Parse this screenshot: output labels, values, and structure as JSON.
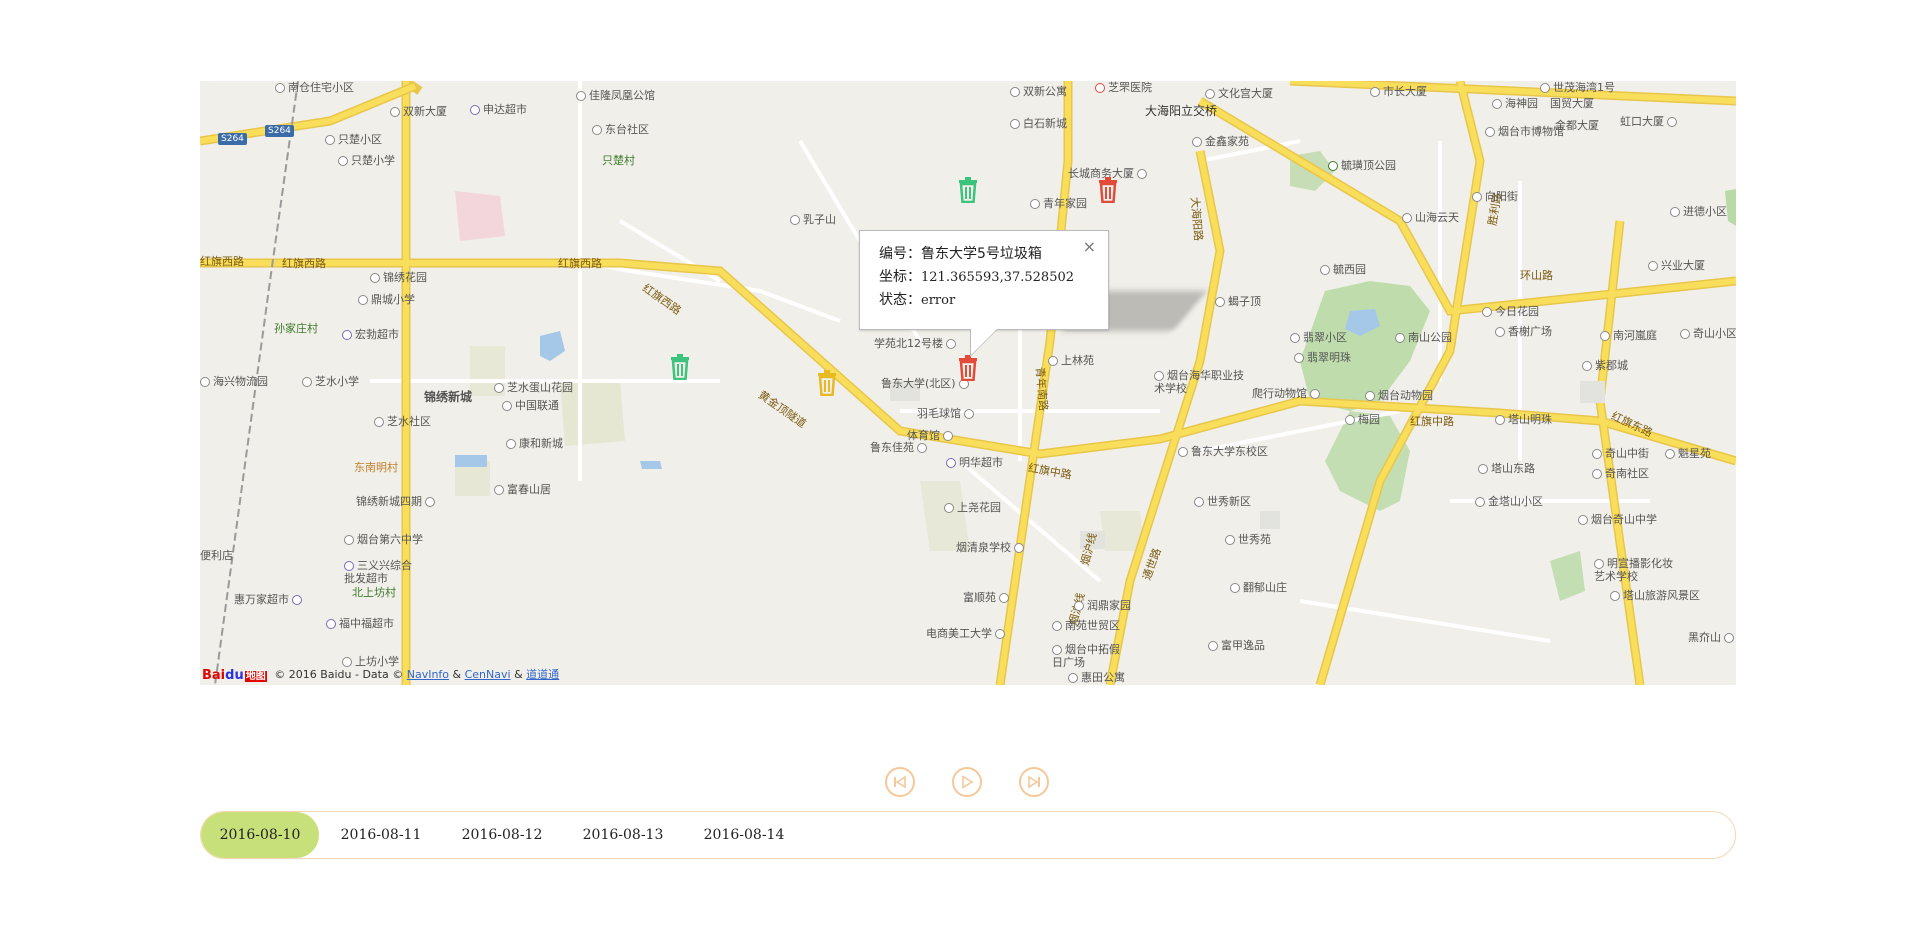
{
  "map": {
    "popup": {
      "id_label": "编号：",
      "id_value": "鲁东大学5号垃圾箱",
      "coord_label": "坐标：",
      "coord_value": "121.365593,37.528502",
      "status_label": "状态：",
      "status_value": "error",
      "close_glyph": "×"
    },
    "attribution": {
      "logo_bai": "Bai",
      "logo_du": "du",
      "logo_map": "地图",
      "copyright": "© 2016 Baidu - Data ©",
      "navinfo": "NavInfo",
      "amp1": "&",
      "cennavi": "CenNavi",
      "amp2": "&",
      "daodaotong": "道道通"
    },
    "bins": [
      {
        "status": "green",
        "color": "#3cc47c"
      },
      {
        "status": "red",
        "color": "#e24a3a"
      },
      {
        "status": "green",
        "color": "#3cc47c"
      },
      {
        "status": "yellow",
        "color": "#e7b923"
      },
      {
        "status": "red-selected",
        "color": "#e24a3a"
      }
    ],
    "pois": [
      "南仓住宅小区",
      "双新大厦",
      "申达超市",
      "佳隆凤凰公馆",
      "双新公寓",
      "芝罘医院",
      "文化宫大厦",
      "市长大厦",
      "世茂海湾1号",
      "只楚小区",
      "东台社区",
      "白石新城",
      "大海阳立交桥",
      "金鑫家苑",
      "海神园",
      "国贸大厦",
      "烟台市博物馆",
      "金都大厦",
      "虹口大厦",
      "只楚小学",
      "只楚村",
      "长城商务大厦",
      "毓璜顶公园",
      "青年家园",
      "向阳街",
      "山海云天",
      "进德小区",
      "乳子山",
      "红旗西路",
      "锦绣花园",
      "毓西园",
      "环山路",
      "兴业大厦",
      "鼎城小学",
      "蝎子顶",
      "孙家庄村",
      "宏勃超市",
      "今日花园",
      "香榭广场",
      "南河嵐庭",
      "奇山小区",
      "翡翠小区",
      "南山公园",
      "学苑北12号楼",
      "鲁东大学(北区)",
      "上林苑",
      "海兴物流园",
      "芝水小学",
      "锦绣新城",
      "芝水蛋山花园",
      "中国联通",
      "翡翠明珠",
      "紫郡城",
      "烟台海华职业技术学校",
      "羽毛球馆",
      "芝水社区",
      "爬行动物馆",
      "烟台动物园",
      "梅园",
      "塔山明珠",
      "体育馆",
      "鲁东佳苑",
      "明华超市",
      "康和新城",
      "红旗中路",
      "鲁东大学东校区",
      "奇山中街",
      "奇南社区",
      "魁星苑",
      "东南明村",
      "塔山东路",
      "富春山居",
      "锦绣新城四期",
      "上尧花园",
      "世秀新区",
      "金塔山小区",
      "烟台奇山中学",
      "烟台第六中学",
      "烟清泉学校",
      "世秀苑",
      "明宣播影化妆艺术学校",
      "三义兴综合批发超市",
      "北上坊村",
      "翻郁山庄",
      "塔山旅游风景区",
      "便利店",
      "惠万家超市",
      "富顺苑",
      "润鼎家园",
      "福中福超市",
      "南苑世贸区",
      "电商美工大学",
      "烟台中拓假日广场",
      "富甲逸品",
      "黑夼山",
      "上坊小学",
      "惠田公寓"
    ],
    "roads": [
      "红旗西路",
      "红旗西路",
      "红旗西路",
      "红旗西路",
      "黄金顶隧道",
      "青年南路",
      "红旗中路",
      "大海阳路",
      "胜利路",
      "环山路",
      "红旗中路",
      "红旗东路",
      "烟沪线",
      "烟沪线",
      "通世路",
      "S264",
      "S264"
    ]
  },
  "controls": {
    "prev": "skip-back",
    "play": "play",
    "next": "skip-forward"
  },
  "timeline": {
    "dates": [
      "2016-08-10",
      "2016-08-11",
      "2016-08-12",
      "2016-08-13",
      "2016-08-14"
    ],
    "active_index": 0,
    "active_color": "#c8e07a",
    "border_color": "#f5d7b3"
  },
  "colors": {
    "control_ring": "#f5c89a",
    "map_bg": "#f1efe9",
    "road_major": "#f8de5b",
    "road_minor": "#ffffff",
    "park": "#b9d9a6"
  }
}
